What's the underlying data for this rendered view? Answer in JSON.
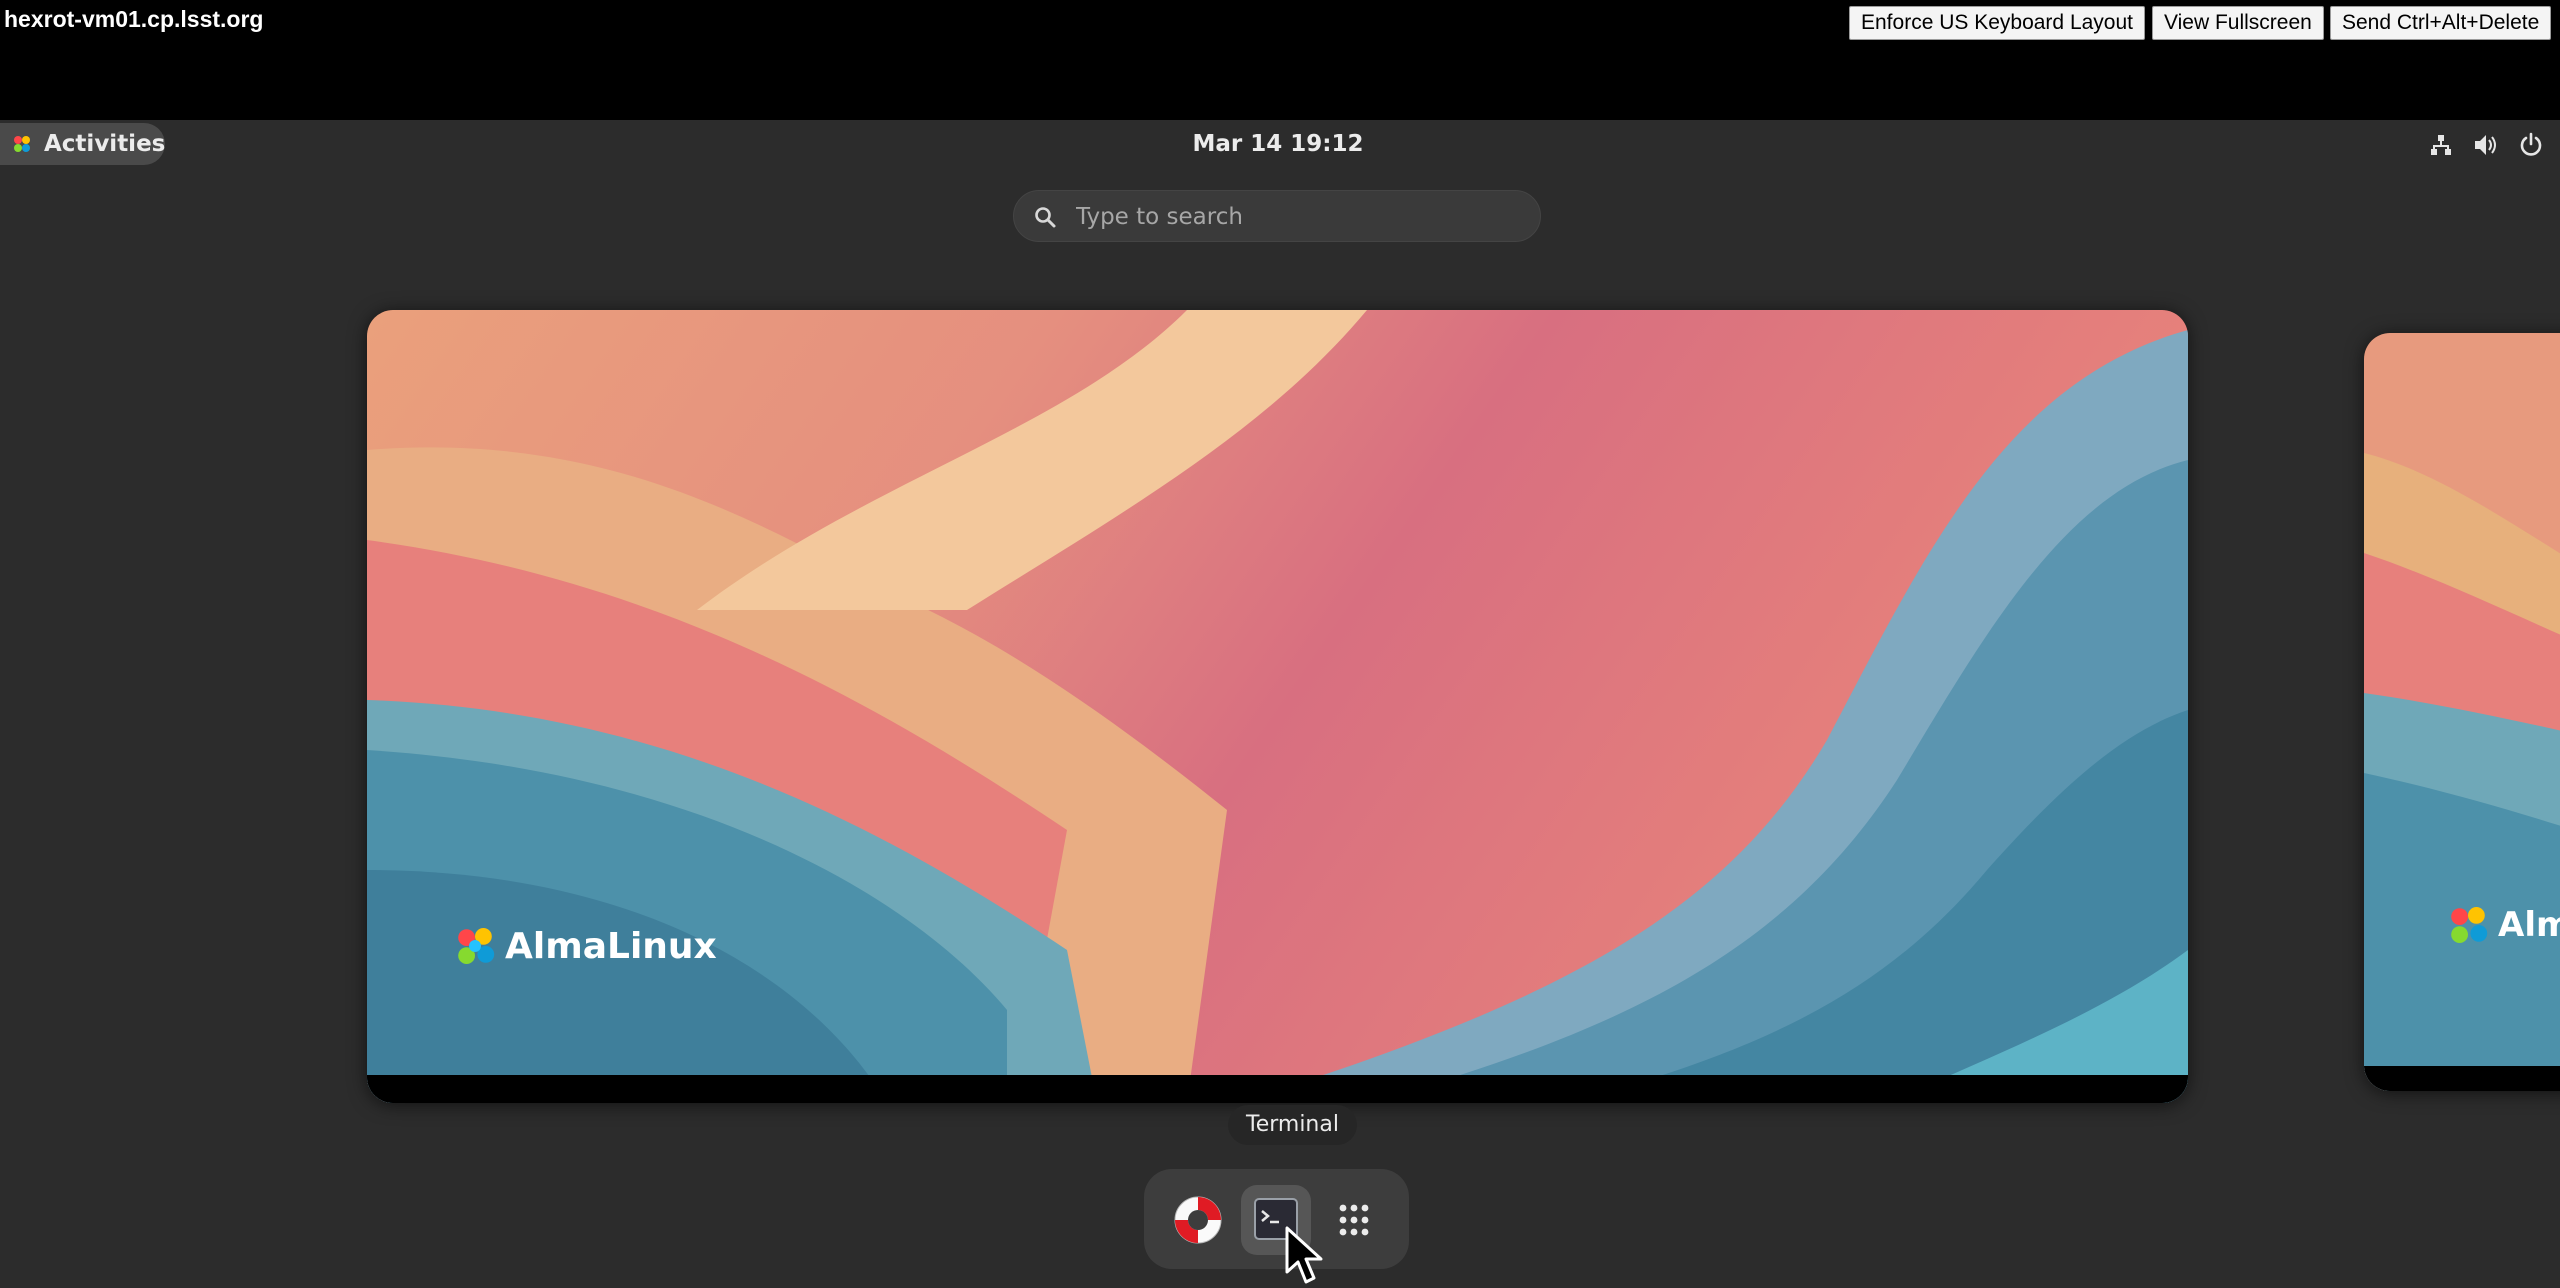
{
  "vnc": {
    "host": "hexrot-vm01.cp.lsst.org",
    "buttons": {
      "keyboard": "Enforce US Keyboard Layout",
      "fullscreen": "View Fullscreen",
      "ctrl_alt_del": "Send Ctrl+Alt+Delete"
    }
  },
  "topbar": {
    "activities": "Activities",
    "clock": "Mar 14  19:12",
    "tray_icons": [
      "network-wired-icon",
      "speaker-volume-icon",
      "power-icon"
    ]
  },
  "search": {
    "placeholder": "Type to search"
  },
  "workspace": {
    "brand": "AlmaLinux",
    "brand_partial": "Alma"
  },
  "dash": {
    "tooltip": "Terminal",
    "apps": [
      "help-lifebuoy-icon",
      "terminal-icon",
      "show-apps-grid-icon"
    ]
  },
  "colors": {
    "desktop_bg": "#2c2c2c",
    "dash_bg": "#3d3d3d",
    "text": "#ececec"
  }
}
